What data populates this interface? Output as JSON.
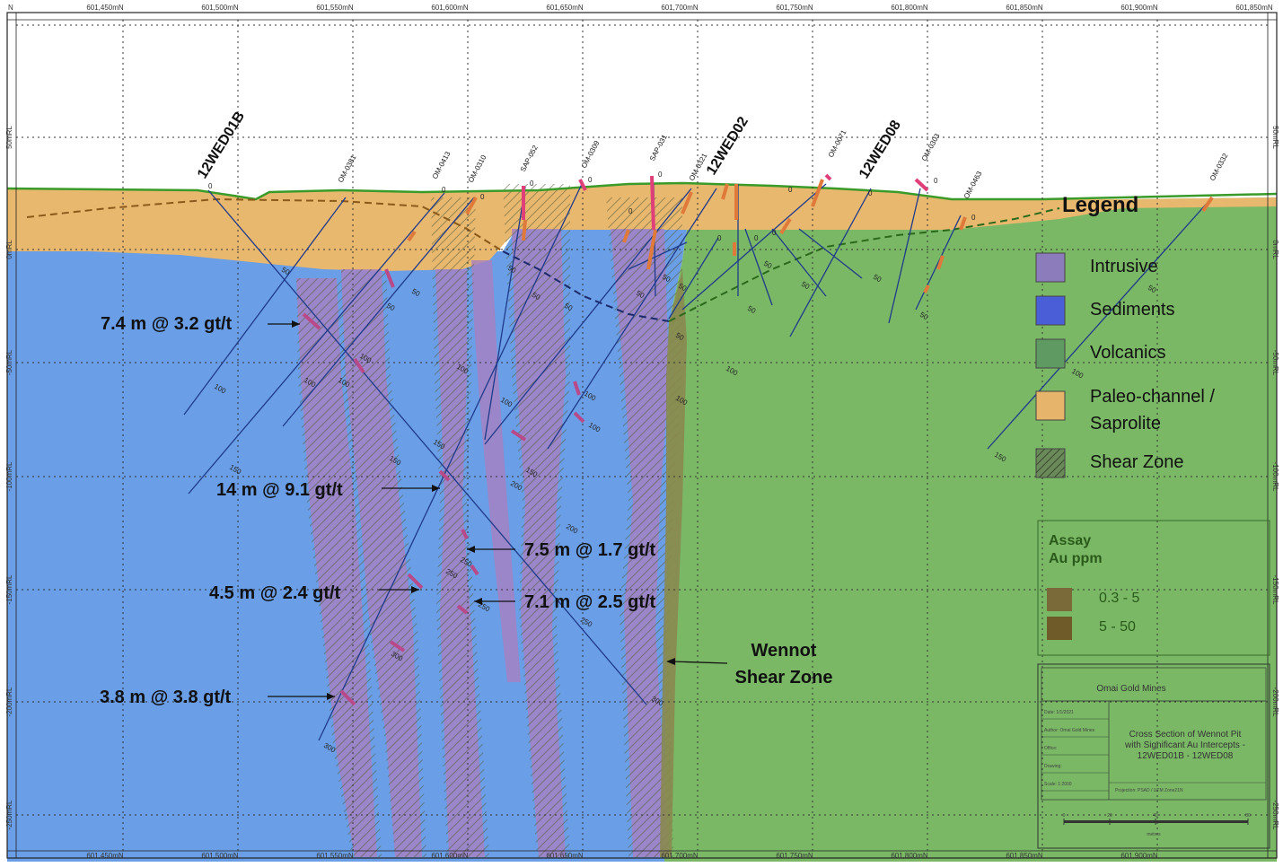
{
  "axes": {
    "northing_top": [
      "601,450mN",
      "601,500mN",
      "601,550mN",
      "601,600mN",
      "601,650mN",
      "601,700mN",
      "601,750mN",
      "601,800mN",
      "601,850mN",
      "601,900mN",
      "601,850mN"
    ],
    "northing_bottom": [
      "601,450mN",
      "601,500mN",
      "601,550mN",
      "601,600mN",
      "601,650mN",
      "601,700mN",
      "601,750mN",
      "601,800mN",
      "601,850mN",
      "601,900mN"
    ],
    "top_left_fragment": "N",
    "elevation_left": [
      "50mRL",
      "0mRL",
      "-50mRL",
      "-100mRL",
      "-150mRL",
      "-200mRL",
      "-250mRL"
    ],
    "elevation_right": [
      "50mRL",
      "0mRL",
      "-50mRL",
      "-100mRL",
      "-150mRL",
      "-200mRL",
      "-250mRL"
    ]
  },
  "holes": {
    "main": [
      "12WED01B",
      "12WED02",
      "12WED08"
    ],
    "small": [
      "OM-0381",
      "OM-0413",
      "OM-0310",
      "SAP-052",
      "OM-0309",
      "SAP-031",
      "OM-0321",
      "OM-0071",
      "OM-0303",
      "OM-0463",
      "OM-0332"
    ]
  },
  "depth_labels": [
    "0",
    "50",
    "100",
    "150",
    "200",
    "250",
    "300"
  ],
  "intercepts": [
    "7.4 m @ 3.2 gt/t",
    "14 m @ 9.1 gt/t",
    "7.5 m @ 1.7 gt/t",
    "4.5 m @ 2.4 gt/t",
    "7.1 m @ 2.5 gt/t",
    "3.8 m @ 3.8 gt/t"
  ],
  "shear_label": [
    "Wennot",
    "Shear Zone"
  ],
  "legend": {
    "title": "Legend",
    "items": [
      {
        "label": "Intrusive",
        "color": "#8c7cbc"
      },
      {
        "label": "Sediments",
        "color": "#4a5ed8"
      },
      {
        "label": "Volcanics",
        "color": "#5f9a62"
      },
      {
        "label": "Paleo-channel /",
        "label2": "Saprolite",
        "color": "#e6b46a"
      },
      {
        "label": "Shear Zone",
        "color": "#4f6b45"
      }
    ]
  },
  "assay": {
    "title1": "Assay",
    "title2": "Au ppm",
    "items": [
      {
        "label": "0.3 - 5",
        "color": "#7a6a3a"
      },
      {
        "label": "5 - 50",
        "color": "#6f5a2a"
      }
    ]
  },
  "title_block": {
    "company": "Omai Gold Mines",
    "title_lines": [
      "Cross Section of Wennot Pit",
      "with Significant Au Intercepts -",
      "12WED01B - 12WED08"
    ],
    "meta": [
      "Date: 1/1/2021",
      "Author: Omai Gold Mines",
      "Office:",
      "Drawing:",
      "Scale: 1:2000"
    ],
    "projection": "Projection: PSAD / UTM Zone21N",
    "scale_ticks": [
      "0",
      "20",
      "40",
      "80"
    ],
    "scale_unit": "metres"
  },
  "colors": {
    "sediments": "#6a9ee6",
    "volcanics": "#7ab866",
    "saprolite": "#e8b86e",
    "intrusive": "#a67fc0",
    "shear": "#8a8850",
    "surface": "#3a9a2a",
    "grade_high": "#e0407a",
    "grade_orange": "#e07a3a"
  }
}
